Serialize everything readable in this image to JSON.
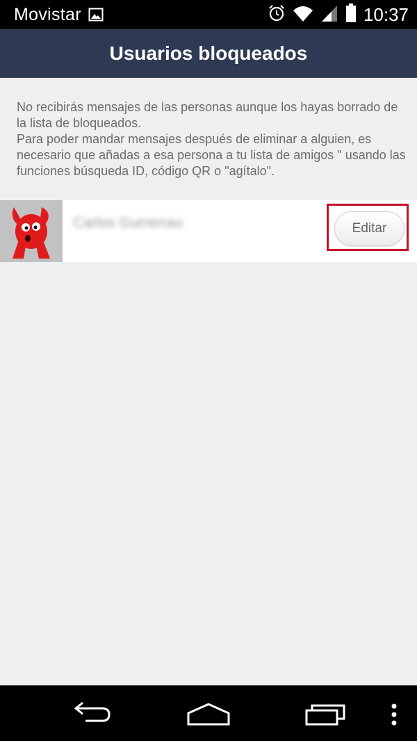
{
  "status_bar": {
    "carrier": "Movistar",
    "time": "10:37",
    "icons": [
      "gallery-icon",
      "alarm-icon",
      "wifi-icon",
      "signal-icon",
      "battery-icon"
    ]
  },
  "header": {
    "title": "Usuarios bloqueados"
  },
  "info": {
    "paragraph_1": "No recibirás mensajes de las personas aunque los hayas borrado de la lista de bloqueados.",
    "paragraph_2": "Para poder mandar mensajes después de eliminar a alguien, es necesario que añadas a esa persona a tu lista de amigos \" usando las funciones búsqueda ID, código QR o \"agítalo\"."
  },
  "blocked_users": [
    {
      "name": "Carlos Gurrerrau",
      "edit_label": "Editar"
    }
  ],
  "colors": {
    "header_bg": "#2e3a54",
    "page_bg": "#efeff2",
    "highlight": "#c40f2e"
  },
  "nav_bar": {
    "icons": [
      "back-icon",
      "home-icon",
      "recents-icon",
      "overflow-menu-icon"
    ]
  }
}
